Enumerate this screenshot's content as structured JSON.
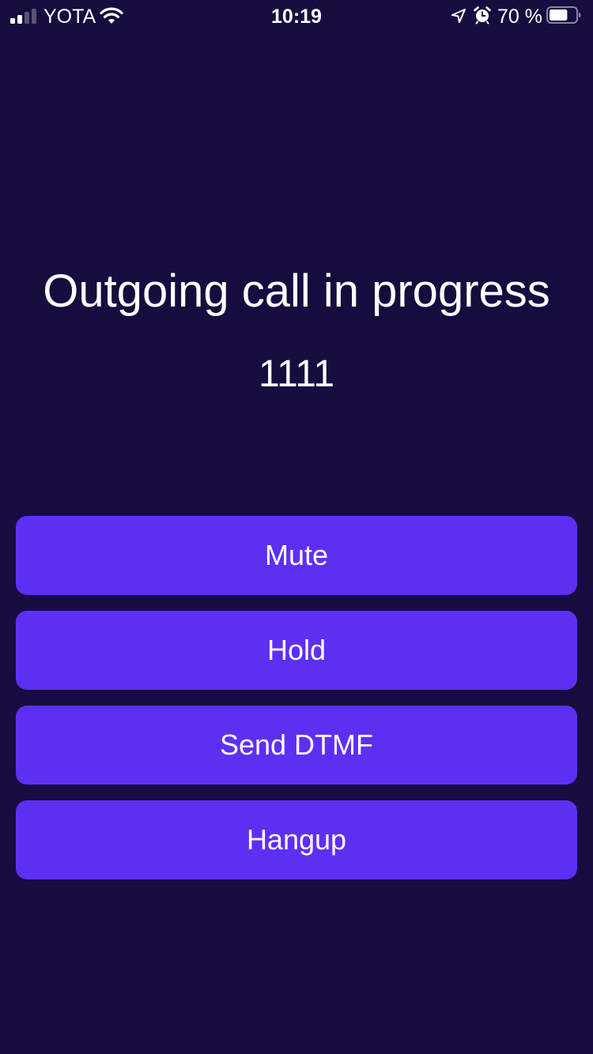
{
  "status_bar": {
    "carrier": "YOTA",
    "time": "10:19",
    "battery_percent": "70 %",
    "signal_bars_filled": 2,
    "signal_bars_total": 4,
    "battery_level": 0.7,
    "icons": [
      "signal-icon",
      "wifi-icon",
      "location-icon",
      "alarm-icon",
      "battery-icon"
    ]
  },
  "call": {
    "title": "Outgoing call in progress",
    "number": "1111"
  },
  "actions": {
    "mute": "Mute",
    "hold": "Hold",
    "send_dtmf": "Send DTMF",
    "hangup": "Hangup"
  },
  "colors": {
    "background": "#170c3f",
    "button": "#5d2ff3",
    "text": "#ffffff"
  }
}
